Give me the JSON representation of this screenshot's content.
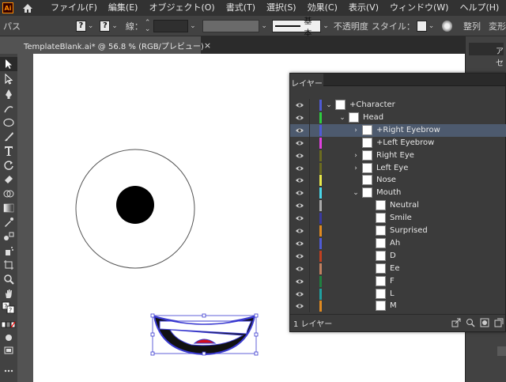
{
  "app": {
    "logo_text": "Ai",
    "menus": [
      "ファイル(F)",
      "編集(E)",
      "オブジェクト(O)",
      "書式(T)",
      "選択(S)",
      "効果(C)",
      "表示(V)",
      "ウィンドウ(W)",
      "ヘルプ(H)"
    ]
  },
  "control": {
    "selection_type": "パス",
    "fill_btn": "?",
    "stroke_btn": "?",
    "stroke_label": "線：",
    "stroke_style": "基本",
    "opacity_label": "不透明度",
    "style_label": "スタイル：",
    "align_label": "整列",
    "transform_label": "変形"
  },
  "document": {
    "tab_title": "TemplateBlank.ai* @ 56.8 % (RGB/プレビュー)",
    "close": "×"
  },
  "dock": {
    "tab_label": "アセ"
  },
  "layers_panel": {
    "tab_label": "レイヤー",
    "rows": [
      {
        "name": "+Character",
        "expanded": true,
        "selected": false,
        "color": "#4f5bd5"
      },
      {
        "name": "Head",
        "expanded": true,
        "selected": false,
        "color": "#2ecc40"
      },
      {
        "name": "+Right Eyebrow",
        "expanded": false,
        "selected": true,
        "color": "#4f5bd5"
      },
      {
        "name": "+Left Eyebrow",
        "expanded": null,
        "selected": false,
        "color": "#e040e0"
      },
      {
        "name": "Right Eye",
        "expanded": false,
        "selected": false,
        "color": "#6b6b20"
      },
      {
        "name": "Left Eye",
        "expanded": false,
        "selected": false,
        "color": "#6b6b20"
      },
      {
        "name": "Nose",
        "expanded": null,
        "selected": false,
        "color": "#e8e84a"
      },
      {
        "name": "Mouth",
        "expanded": true,
        "selected": false,
        "color": "#4ad6e8"
      },
      {
        "name": "Neutral",
        "expanded": null,
        "selected": false,
        "color": "#aaaaaa"
      },
      {
        "name": "Smile",
        "expanded": null,
        "selected": false,
        "color": "#3a3aa0"
      },
      {
        "name": "Surprised",
        "expanded": null,
        "selected": false,
        "color": "#e08a20"
      },
      {
        "name": "Ah",
        "expanded": null,
        "selected": false,
        "color": "#4f5bd5"
      },
      {
        "name": "D",
        "expanded": null,
        "selected": false,
        "color": "#c04020"
      },
      {
        "name": "Ee",
        "expanded": null,
        "selected": false,
        "color": "#c08060"
      },
      {
        "name": "F",
        "expanded": null,
        "selected": false,
        "color": "#208040"
      },
      {
        "name": "L",
        "expanded": null,
        "selected": false,
        "color": "#20a0a0"
      },
      {
        "name": "M",
        "expanded": null,
        "selected": false,
        "color": "#e08a20"
      }
    ],
    "footer_count": "1 レイヤー"
  },
  "colors": {
    "selection_blue": "#3a3ad0",
    "mouth_red": "#d01020"
  }
}
